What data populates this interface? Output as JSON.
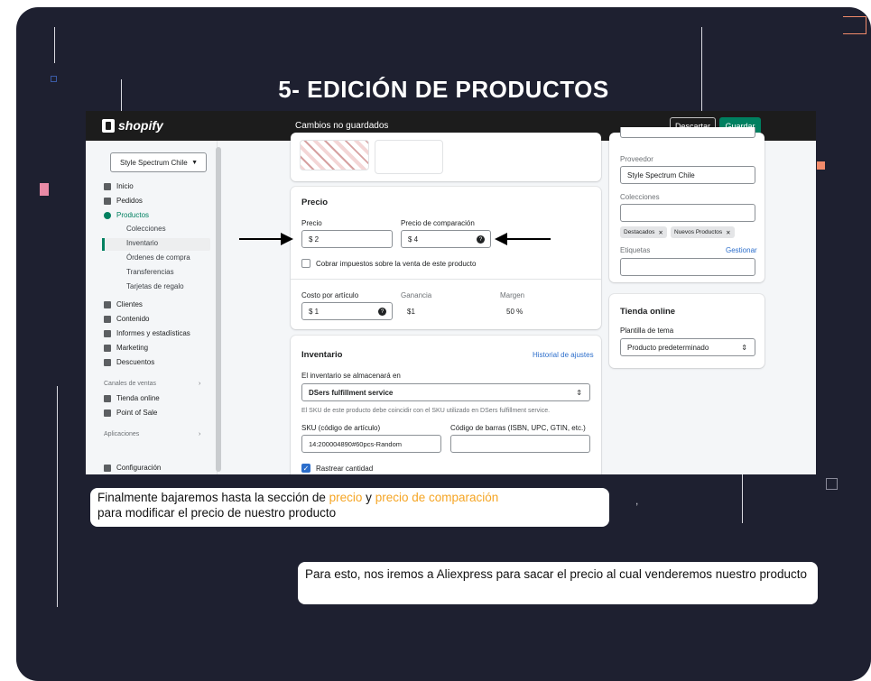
{
  "slide": {
    "title": "5- EDICIÓN DE PRODUCTOS",
    "callout1": {
      "before": "Finalmente bajaremos hasta la sección de ",
      "hl1": "precio",
      "mid": " y ",
      "hl2": "precio de comparación",
      "after": "para modificar el precio de nuestro producto"
    },
    "callout2": "Para esto, nos iremos a Aliexpress para sacar el precio al cual venderemos nuestro producto",
    "stray_mark": ",",
    "colors": {
      "background": "#1e2030",
      "highlight": "#f5a524",
      "shopify_green": "#008060",
      "accent_square": "#f28b6b",
      "pink_square": "#e98aa6"
    }
  },
  "shopify": {
    "logo": "shopify",
    "topbar": {
      "status": "Cambios no guardados",
      "discard": "Descartar",
      "save": "Guardar"
    },
    "store": "Style Spectrum Chile",
    "nav": {
      "inicio": "Inicio",
      "pedidos": "Pedidos",
      "productos": "Productos",
      "colecciones": "Colecciones",
      "inventario": "Inventario",
      "ordenes": "Órdenes de compra",
      "transferencias": "Transferencias",
      "tarjetas": "Tarjetas de regalo",
      "clientes": "Clientes",
      "contenido": "Contenido",
      "informes": "Informes y estadísticas",
      "marketing": "Marketing",
      "descuentos": "Descuentos",
      "canales": "Canales de ventas",
      "tienda": "Tienda online",
      "pos": "Point of Sale",
      "aplicaciones": "Aplicaciones",
      "configuracion": "Configuración"
    },
    "precio": {
      "title": "Precio",
      "precio_label": "Precio",
      "precio_value": "$ 2",
      "comparacion_label": "Precio de comparación",
      "comparacion_value": "$ 4",
      "impuestos": "Cobrar impuestos sobre la venta de este producto",
      "costo_label": "Costo por artículo",
      "costo_value": "$ 1",
      "ganancia_label": "Ganancia",
      "ganancia_value": "$1",
      "margen_label": "Margen",
      "margen_value": "50 %"
    },
    "inventario": {
      "title": "Inventario",
      "historial": "Historial de ajustes",
      "almacen_label": "El inventario se almacenará en",
      "almacen_value": "DSers fulfillment service",
      "sku_note": "El SKU de este producto debe coincidir con el SKU utilizado en DSers fulfillment service.",
      "sku_label": "SKU (código de artículo)",
      "sku_value": "14:200004890#60pcs-Random",
      "barcode_label": "Código de barras (ISBN, UPC, GTIN, etc.)",
      "barcode_value": "",
      "rastrear": "Rastrear cantidad"
    },
    "org": {
      "proveedor_label": "Proveedor",
      "proveedor_value": "Style Spectrum Chile",
      "colecciones_label": "Colecciones",
      "tag1": "Destacados",
      "tag2": "Nuevos Productos",
      "etiquetas_label": "Etiquetas",
      "gestionar": "Gestionar"
    },
    "tienda_online": {
      "title": "Tienda online",
      "plantilla_label": "Plantilla de tema",
      "plantilla_value": "Producto predeterminado"
    }
  }
}
